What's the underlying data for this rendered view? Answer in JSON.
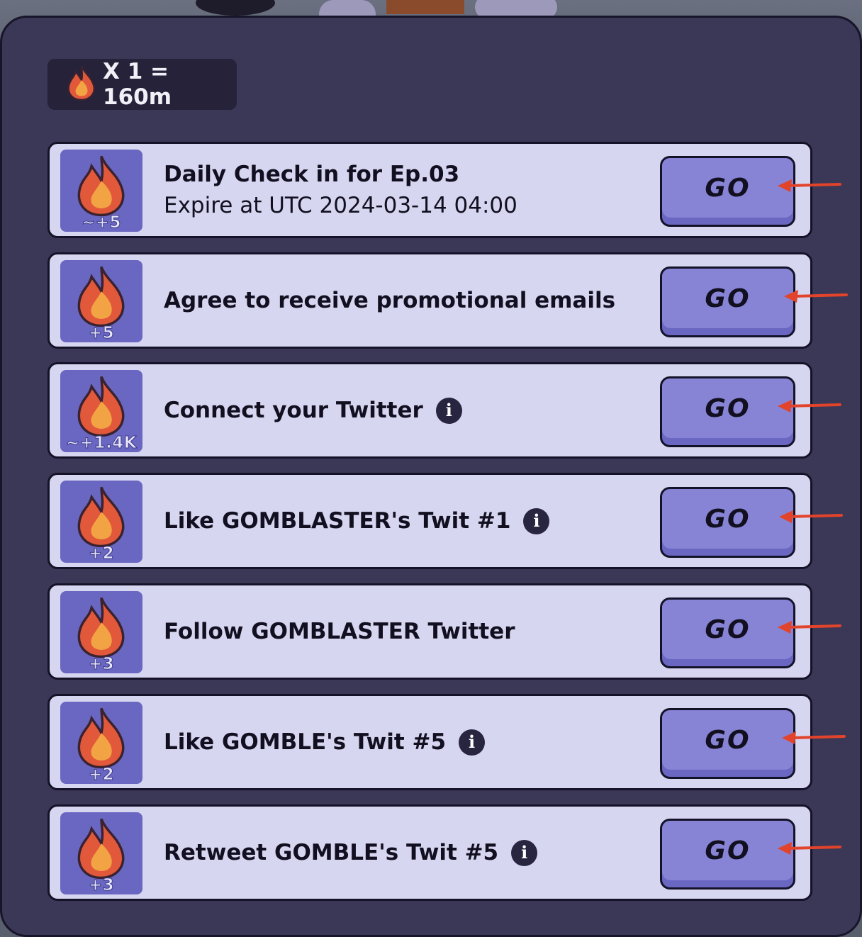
{
  "header": {
    "badge_icon": "flame-icon",
    "badge_text": "X 1 = 160m"
  },
  "tasks": [
    {
      "reward": "~+5",
      "title": "Daily Check in for Ep.03",
      "subtitle": "Expire at UTC 2024-03-14 04:00",
      "info": false,
      "button": "GO"
    },
    {
      "reward": "+5",
      "title": "Agree to receive promotional emails",
      "subtitle": "",
      "info": false,
      "button": "GO"
    },
    {
      "reward": "~+1.4K",
      "title": "Connect your Twitter",
      "subtitle": "",
      "info": true,
      "button": "GO"
    },
    {
      "reward": "+2",
      "title": "Like GOMBLASTER's Twit #1",
      "subtitle": "",
      "info": true,
      "button": "GO"
    },
    {
      "reward": "+3",
      "title": "Follow GOMBLASTER Twitter",
      "subtitle": "",
      "info": false,
      "button": "GO"
    },
    {
      "reward": "+2",
      "title": "Like GOMBLE's Twit #5",
      "subtitle": "",
      "info": true,
      "button": "GO"
    },
    {
      "reward": "+3",
      "title": "Retweet GOMBLE's Twit #5",
      "subtitle": "",
      "info": true,
      "button": "GO"
    }
  ],
  "info_icon_glyph": "i",
  "colors": {
    "panel": "#3b3756",
    "card": "#d7d6f0",
    "reward_tile": "#6a67c2",
    "button": "#8784d6",
    "annotation_arrow": "#e2432b"
  }
}
